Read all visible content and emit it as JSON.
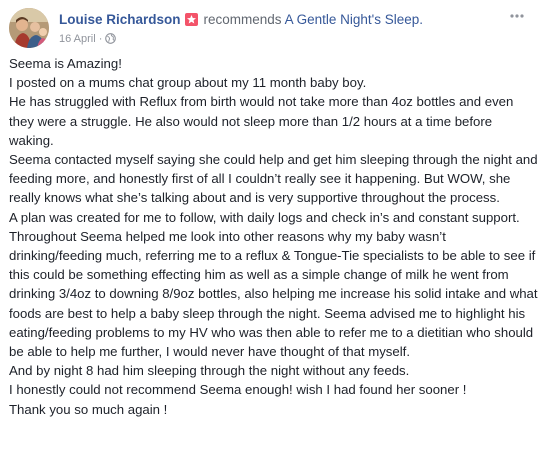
{
  "post": {
    "author": "Louise Richardson",
    "recommends_text": "recommends",
    "page_name": "A Gentle Night's Sleep.",
    "date": "16 April",
    "dot": "·",
    "badge_color": "#f35369",
    "icons": {
      "recommend_badge": "star-icon",
      "privacy": "globe-icon",
      "menu": "more-options-icon"
    },
    "lines": [
      "Seema is Amazing!",
      "I posted on a mums chat group about my 11 month baby boy.",
      "He has struggled with Reflux from birth would not take more than 4oz bottles and even they were a struggle. He also would not sleep more than 1/2 hours at a time before waking.",
      "Seema contacted myself saying she could help and get him sleeping through the night and feeding more, and honestly first of all I couldn’t really see it happening. But WOW, she really knows what she’s talking about and is very supportive throughout the process.",
      "A plan was created for me to follow, with daily logs and check in’s and constant support. Throughout Seema helped me look into other reasons why my baby wasn’t drinking/feeding much, referring me to a reflux & Tongue-Tie specialists to be able to see if this could be something effecting him as well as a simple change of milk he went from drinking 3/4oz to downing 8/9oz bottles, also helping me increase his solid intake and what foods are best to help a baby sleep through the night. Seema advised me to highlight his eating/feeding problems to my HV who was then able to refer me to a dietitian who should be able to help me further, I would never have thought of that myself.",
      "And by night 8 had him sleeping through the night without any feeds.",
      "I honestly could not recommend Seema enough! wish I had found her sooner !",
      "Thank you so much again !"
    ]
  }
}
